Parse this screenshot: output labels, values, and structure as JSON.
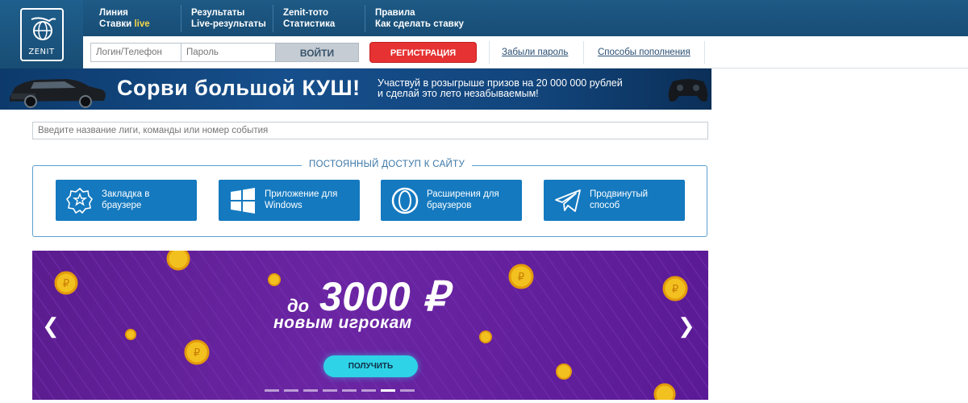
{
  "logo": {
    "text": "ZENIT",
    "icon": "zenit-globe-icon"
  },
  "nav": {
    "col1": {
      "line1": "Линия",
      "line2_prefix": "Ставки ",
      "line2_highlight": "live"
    },
    "col2": {
      "line1": "Результаты",
      "line2": "Live-результаты"
    },
    "col3": {
      "line1": "Zenit-тото",
      "line2": "Статистика"
    },
    "col4": {
      "line1": "Правила",
      "line2": "Как сделать ставку"
    }
  },
  "login": {
    "login_placeholder": "Логин/Телефон",
    "password_placeholder": "Пароль",
    "login_button": "ВОЙТИ",
    "register_button": "РЕГИСТРАЦИЯ",
    "forgot_link": "Забыли пароль",
    "deposit_link": "Способы пополнения"
  },
  "promo": {
    "title": "Сорви большой КУШ!",
    "subtitle_line1": "Участвуй в розыгрыше призов на 20 000 000 рублей",
    "subtitle_line2": "и сделай это лето незабываемым!"
  },
  "search": {
    "placeholder": "Введите название лиги, команды или номер события"
  },
  "access": {
    "title": "ПОСТОЯННЫЙ ДОСТУП К САЙТУ",
    "tiles": [
      {
        "line1": "Закладка в",
        "line2": "браузере",
        "icon": "bookmark-star-icon"
      },
      {
        "line1": "Приложение для",
        "line2": "Windows",
        "icon": "windows-icon"
      },
      {
        "line1": "Расширения для",
        "line2": "браузеров",
        "icon": "opera-icon"
      },
      {
        "line1": "Продвинутый",
        "line2": "способ",
        "icon": "telegram-icon"
      }
    ]
  },
  "hero": {
    "prefix": "до",
    "amount": "3000 ₽",
    "subtitle": "новым игрокам",
    "button": "ПОЛУЧИТЬ",
    "slides_total": 8,
    "active_slide": 7
  },
  "colors": {
    "header_bg": "#1e5a86",
    "register_red": "#e63232",
    "tile_blue": "#1479bf",
    "hero_purple": "#6b25a3",
    "cta_cyan": "#2fd3e8"
  }
}
